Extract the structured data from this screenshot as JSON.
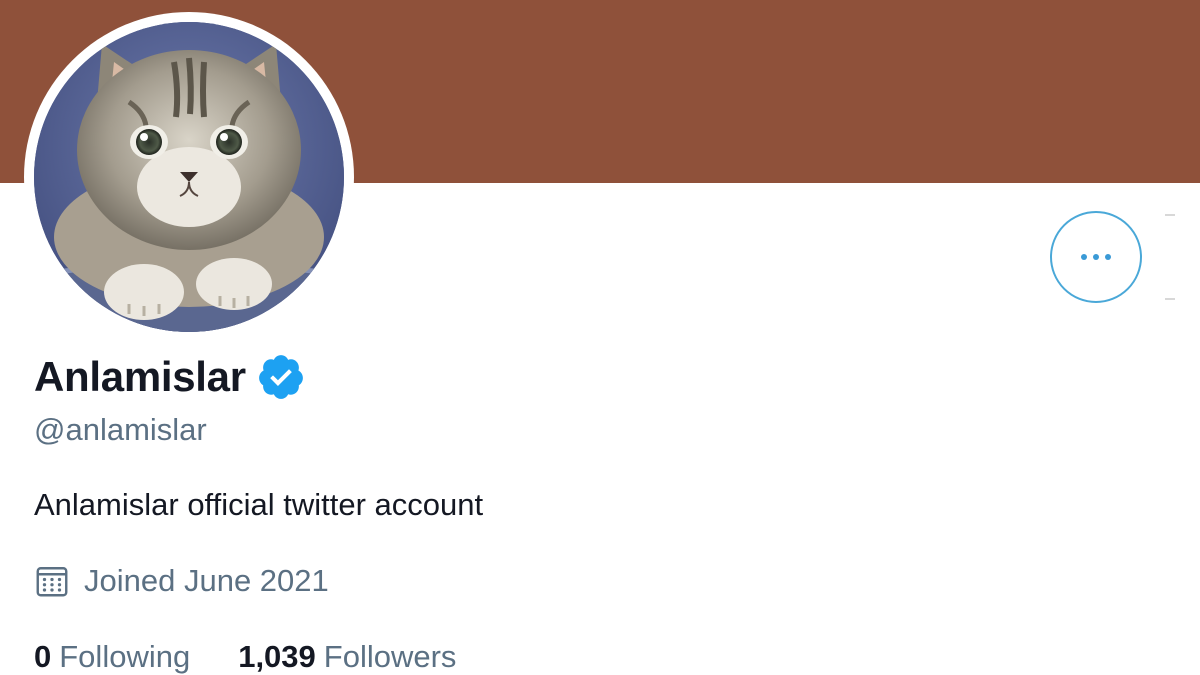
{
  "profile": {
    "display_name": "Anlamislar",
    "verified": true,
    "handle": "@anlamislar",
    "bio": "Anlamislar official twitter account",
    "joined": "Joined June 2021",
    "following_count": "0",
    "following_label": "Following",
    "followers_count": "1,039",
    "followers_label": "Followers"
  },
  "icons": {
    "avatar": "kitten-photo",
    "verified": "verified-badge-icon",
    "calendar": "calendar-icon",
    "more": "more-options-icon"
  },
  "colors": {
    "banner": "#8f513a",
    "accent": "#1da1f2",
    "text_primary": "#141823",
    "text_secondary": "#5b7083"
  }
}
